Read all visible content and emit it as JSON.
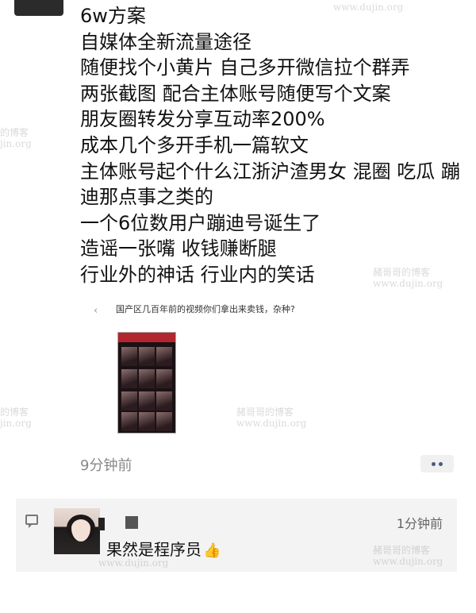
{
  "post": {
    "lines": [
      "6w方案",
      "自媒体全新流量途径",
      "随便找个小黄片 自己多开微信拉个群弄",
      "两张截图 配合主体账号随便写个文案",
      "朋友圈转发分享互动率200%",
      "成本几个多开手机一篇软文",
      "主体账号起个什么江浙沪渣男女 混圈 吃瓜 蹦迪那点事之类的",
      "一个6位数用户蹦迪号诞生了",
      "造谣一张嘴 收钱赚断腿",
      "行业外的神话 行业内的笑话"
    ],
    "shared_title": "国产区几百年前的视频你们拿出来卖钱，杂种?",
    "time": "9分钟前"
  },
  "comment": {
    "time": "1分钟前",
    "text": "果然是程序员",
    "emoji": "👍"
  },
  "watermark": {
    "top": "www.dujin.org",
    "cn": "赭哥哥的博客",
    "cn_short": "的博客",
    "en_short": "jin.org"
  },
  "icons": {
    "more": "more-dots-icon",
    "comment": "comment-bubble-icon",
    "back": "back-arrow-icon"
  }
}
